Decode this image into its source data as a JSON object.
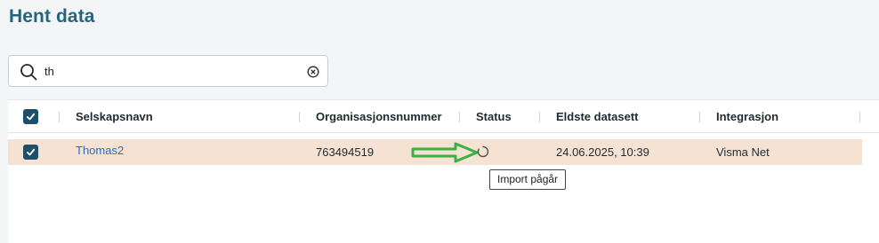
{
  "page": {
    "title": "Hent data"
  },
  "search": {
    "value": "th",
    "icon": "search-icon",
    "clear_icon": "clear-icon"
  },
  "table": {
    "columns": [
      "Selskapsnavn",
      "Organisasjonsnummer",
      "Status",
      "Eldste datasett",
      "Integrasjon"
    ],
    "rows": [
      {
        "selected": true,
        "company": "Thomas2",
        "org_number": "763494519",
        "status_icon": "loading-spinner-icon",
        "oldest_dataset": "24.06.2025, 10:39",
        "integration": "Visma Net"
      }
    ]
  },
  "tooltip": {
    "text": "Import pågår"
  },
  "colors": {
    "title": "#23667e",
    "checkbox": "#1f4e6b",
    "row_highlight": "#f5e2d3",
    "link": "#2f6fb0",
    "annotation_arrow": "#3cb043"
  }
}
